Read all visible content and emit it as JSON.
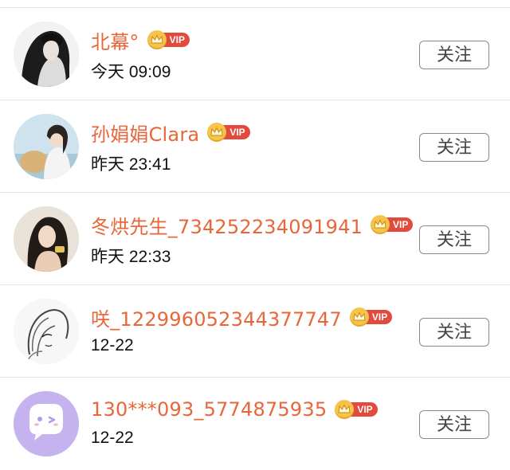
{
  "follow_label": "关注",
  "vip_label": "VIP",
  "colors": {
    "name": "#e8663a",
    "vip_tag": "#e24b3c",
    "vip_crown": "#f6c44a",
    "divider": "#e6e6e6"
  },
  "users": [
    {
      "name": "北幕°",
      "time": "今天 09:09",
      "vip": true,
      "avatar": "photo-dark-hair"
    },
    {
      "name": "孙娟娟Clara",
      "time": "昨天 23:41",
      "vip": true,
      "avatar": "photo-beach-hat"
    },
    {
      "name": "冬烘先生_734252234091941",
      "time": "昨天 22:33",
      "vip": true,
      "avatar": "photo-woman-phone"
    },
    {
      "name": "咲_122996052344377747",
      "time": "12-22",
      "vip": true,
      "avatar": "sketch-anime-girl"
    },
    {
      "name": "130***093_5774875935",
      "time": "12-22",
      "vip": true,
      "avatar": "default-chat-bubble"
    }
  ]
}
